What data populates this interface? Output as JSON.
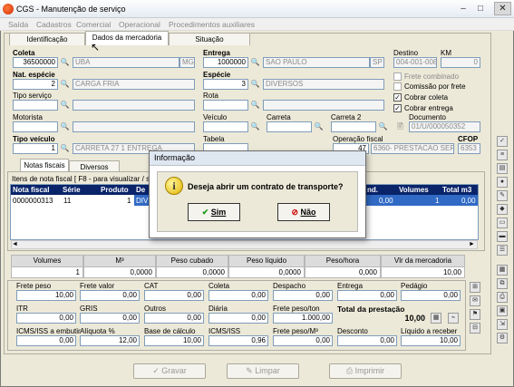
{
  "window": {
    "title": "CGS - Manutenção de serviço",
    "close": "✕"
  },
  "menu": [
    "Saída",
    "Cadastros",
    "Comercial",
    "Operacional",
    "Procedimentos auxiliares"
  ],
  "tabs": [
    "Identificação",
    "Dados da mercadoria",
    "Situação"
  ],
  "coleta": {
    "label": "Coleta",
    "code": "36500000",
    "city": "UBA",
    "uf": "MG"
  },
  "entrega": {
    "label": "Entrega",
    "code": "1000000",
    "city": "SAO PAULO",
    "uf": "SP"
  },
  "destino": {
    "label": "Destino",
    "value": "004-001-008"
  },
  "km": {
    "label": "KM",
    "value": "0"
  },
  "nat": {
    "label": "Nat. espécie",
    "code": "2",
    "desc": "CARGA FRIA"
  },
  "especie": {
    "label": "Espécie",
    "code": "3",
    "desc": "DIVERSOS"
  },
  "tipo_servico": {
    "label": "Tipo serviço"
  },
  "rota": {
    "label": "Rota"
  },
  "checks": {
    "frete_combinado": "Frete combinado",
    "comissao": "Comissão por frete",
    "cobrar_coleta": "Cobrar coleta",
    "cobrar_entrega": "Cobrar entrega"
  },
  "motorista": {
    "label": "Motorista"
  },
  "veiculo": {
    "label": "Veículo"
  },
  "carreta": {
    "label": "Carreta"
  },
  "carreta2": {
    "label": "Carreta 2"
  },
  "documento": {
    "label": "Documento",
    "value": "01/U/000050352"
  },
  "tipo_veiculo": {
    "label": "Tipo veículo",
    "code": "1",
    "desc": "CARRETA 27 1 ENTREGA"
  },
  "tabela": {
    "label": "Tabela"
  },
  "operacao": {
    "label": "Operação fiscal",
    "code": "47",
    "desc": "6360- PRESTACAO SERV"
  },
  "cfop": {
    "label": "CFOP",
    "value": "6353"
  },
  "subtabs": [
    "Notas fiscais",
    "Diversos"
  ],
  "nf_group": "Itens de nota fiscal [ F8 - para visualizar / s",
  "nf_grid": {
    "headers": [
      "Nota fiscal",
      "Série",
      "Produto",
      "De"
    ],
    "row": [
      "0000000313",
      "11",
      "1",
      "DIV"
    ],
    "right_headers": [
      "nd.",
      "Volumes",
      "Total m3"
    ],
    "right_row": [
      "0,00",
      "1",
      "0,00"
    ]
  },
  "summary": {
    "headers": [
      "Volumes",
      "M³",
      "Peso cubado",
      "Peso líquido",
      "Peso/hora",
      "Vlr da mercadoria"
    ],
    "values": [
      "1",
      "0,0000",
      "0,0000",
      "0,0000",
      "0,000",
      "10,00"
    ]
  },
  "fields_row1": {
    "labels": [
      "Frete peso",
      "Frete valor",
      "CAT",
      "Coleta",
      "Despacho",
      "Entrega",
      "Pedágio"
    ],
    "values": [
      "10,00",
      "0,00",
      "0,00",
      "0,00",
      "0,00",
      "0,00",
      "0,00"
    ]
  },
  "fields_row2": {
    "labels": [
      "ITR",
      "GRIS",
      "Outros",
      "Diária",
      "Frete peso/ton",
      "Total da prestação"
    ],
    "values": [
      "0,00",
      "0,00",
      "0,00",
      "0,00",
      "1.000,00",
      "10,00"
    ]
  },
  "fields_row3": {
    "labels": [
      "ICMS/ISS a embutir",
      "Alíquota %",
      "Base de cálculo",
      "ICMS/ISS",
      "Frete peso/M³",
      "Desconto",
      "Líquido a receber"
    ],
    "values": [
      "0,00",
      "12,00",
      "10,00",
      "0,96",
      "0,00",
      "0,00",
      "10,00"
    ]
  },
  "bottom_buttons": [
    "Gravar",
    "Limpar",
    "Imprimir"
  ],
  "dialog": {
    "title": "Informação",
    "message": "Deseja abrir um contrato de transporte?",
    "yes": "Sim",
    "no": "Não",
    "icon": "i"
  }
}
